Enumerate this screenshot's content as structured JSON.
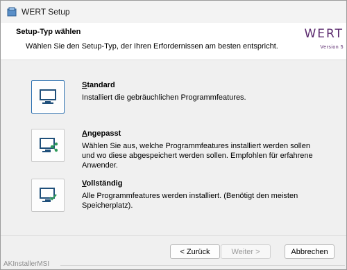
{
  "window": {
    "title": "WERT Setup",
    "icon": "installer-icon"
  },
  "header": {
    "title": "Setup-Typ wählen",
    "subtitle": "Wählen Sie den Setup-Typ, der Ihren Erfordernissen am besten entspricht.",
    "logo_text": "WERT",
    "logo_version": "Version 5",
    "brand_color": "#5b2a6e"
  },
  "options": [
    {
      "name": "Standard",
      "hotkey": "S",
      "rest": "tandard",
      "description": "Installiert die gebräuchlichen Programmfeatures.",
      "icon": "monitor-icon",
      "selected": true
    },
    {
      "name": "Angepasst",
      "hotkey": "A",
      "rest": "ngepasst",
      "description": "Wählen Sie aus, welche Programmfeatures installiert werden sollen und wo diese abgespeichert werden sollen. Empfohlen für erfahrene Anwender.",
      "icon": "monitor-share-icon",
      "selected": false
    },
    {
      "name": "Vollständig",
      "hotkey": "V",
      "rest": "ollständig",
      "description": "Alle Programmfeatures werden installiert. (Benötigt den meisten Speicherplatz).",
      "icon": "monitor-check-icon",
      "selected": false
    }
  ],
  "footer": {
    "installer_brand": "AKInstallerMSI",
    "back_label": "< Zurück",
    "next_label": "Weiter >",
    "cancel_label": "Abbrechen",
    "next_enabled": false
  },
  "colors": {
    "accent": "#2a6fb0",
    "icon_teal": "#1f6f7a",
    "icon_green": "#2e9a5a"
  }
}
